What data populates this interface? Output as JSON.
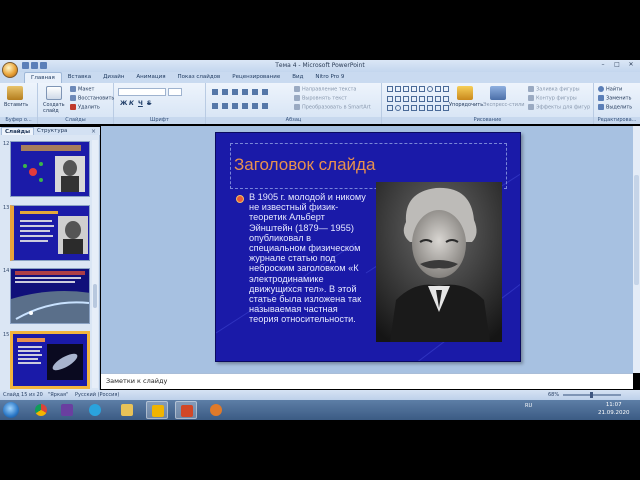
{
  "window": {
    "title": "Тема 4 - Microsoft PowerPoint",
    "controls": [
      "–",
      "□",
      "✕"
    ]
  },
  "tabs": [
    "Главная",
    "Вставка",
    "Дизайн",
    "Анимация",
    "Показ слайдов",
    "Рецензирование",
    "Вид",
    "Nitro Pro 9"
  ],
  "ribbon": {
    "clipboard": {
      "paste": "Вставить",
      "label": "Буфер о..."
    },
    "slides": {
      "new_slide": "Создать слайд",
      "layout": "Макет",
      "reset": "Восстановить",
      "delete": "Удалить",
      "label": "Слайды"
    },
    "font": {
      "label": "Шрифт",
      "bold": "Ж",
      "italic": "К",
      "underline": "Ч",
      "strike": "S"
    },
    "paragraph": {
      "direction": "Направление текста",
      "align": "Выровнять текст",
      "smartart": "Преобразовать в SmartArt",
      "label": "Абзац"
    },
    "drawing": {
      "arrange": "Упорядочить",
      "styles": "Экспресс-стили",
      "fill": "Заливка фигуры",
      "outline": "Контур фигуры",
      "effects": "Эффекты для фигур",
      "label": "Рисование"
    },
    "editing": {
      "find": "Найти",
      "replace": "Заменить",
      "select": "Выделить",
      "label": "Редактирова..."
    }
  },
  "pane": {
    "tab_slides": "Слайды",
    "tab_outline": "Структура",
    "close": "×",
    "thumbnails": [
      {
        "num": "12"
      },
      {
        "num": "13"
      },
      {
        "num": "14"
      },
      {
        "num": "15"
      }
    ]
  },
  "slide": {
    "title": "Заголовок слайда",
    "body": "В 1905 г. молодой и никому не известный физик-теоретик Альберт Эйнштейн (1879— 1955) опубликовал в специальном физическом журнале статью под неброским заголовком «К электродинамике движущихся тел». В этой статье была изложена так называемая частная теория относительности."
  },
  "notes": {
    "placeholder": "Заметки к слайду"
  },
  "status": {
    "slide_counter": "Слайд 15 из 20",
    "theme": "\"Яркая\"",
    "language": "Русский (Россия)",
    "zoom": "68%"
  },
  "taskbar": {
    "lang": "RU",
    "time": "11:07",
    "date": "21.09.2020"
  },
  "colors": {
    "slide_bg": "#1a1aa8",
    "title_orange": "#e8914e",
    "thumb_selected": "#f3b53d"
  }
}
